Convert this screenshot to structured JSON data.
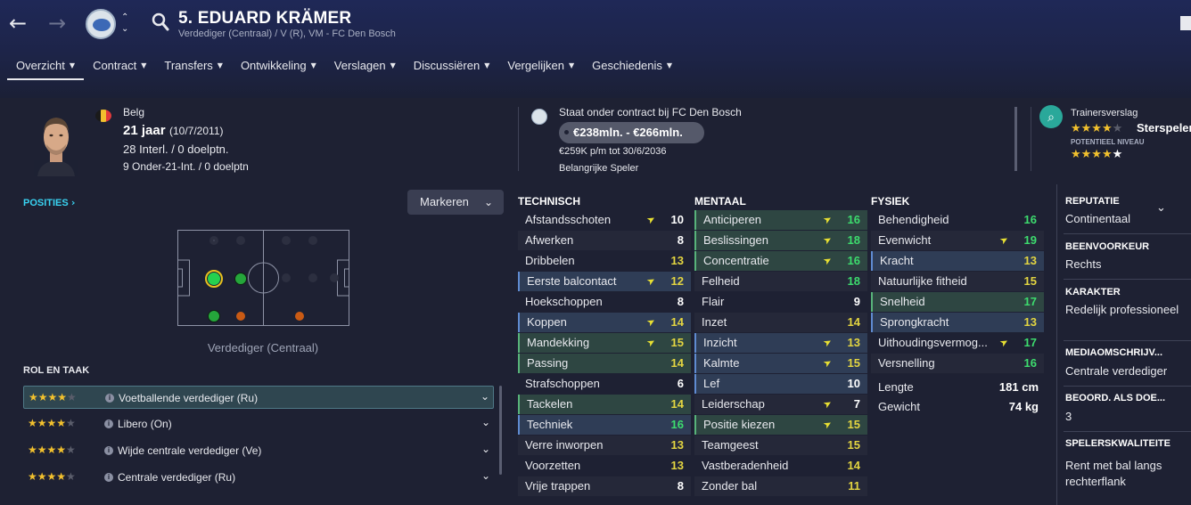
{
  "header": {
    "player_name": "5. EDUARD KRÄMER",
    "player_sub": "Verdediger (Centraal) / V (R), VM - FC Den Bosch",
    "tabs": [
      {
        "label": "Overzicht"
      },
      {
        "label": "Contract"
      },
      {
        "label": "Transfers"
      },
      {
        "label": "Ontwikkeling"
      },
      {
        "label": "Verslagen"
      },
      {
        "label": "Discussiëren"
      },
      {
        "label": "Vergelijken"
      },
      {
        "label": "Geschiedenis"
      }
    ]
  },
  "profile": {
    "nationality": "Belg",
    "age": "21 jaar",
    "dob": "(10/7/2011)",
    "caps": "28 Interl. / 0 doelptn.",
    "u21_caps": "9 Onder-21-Int. / 0 doelptn",
    "flag_colors": [
      "#1a1a1a",
      "#f2c12e",
      "#e23b3b"
    ]
  },
  "contract": {
    "status": "Staat onder contract bij FC Den Bosch",
    "value": "€238mln. - €266mln.",
    "wage": "€259K p/m tot 30/6/2036",
    "role": "Belangrijke Speler"
  },
  "scout": {
    "title": "Trainersverslag",
    "current_ability_stars": 4,
    "verdict": "Sterspeler",
    "potential_label": "POTENTIEEL NIVEAU",
    "potential_stars": 5
  },
  "left": {
    "posities": "POSITIES",
    "markeren": "Markeren",
    "pitch_label": "Verdediger (Centraal)",
    "rol_title": "ROL EN TAAK",
    "roles": [
      {
        "name": "Voetballende verdediger (Ru)",
        "stars": 4
      },
      {
        "name": "Libero (On)",
        "stars": 4
      },
      {
        "name": "Wijde centrale verdediger (Ve)",
        "stars": 4
      },
      {
        "name": "Centrale verdediger (Ru)",
        "stars": 4
      }
    ]
  },
  "technisch": {
    "title": "TECHNISCH",
    "items": [
      {
        "name": "Afstandsschoten",
        "value": "10",
        "arrow": true
      },
      {
        "name": "Afwerken",
        "value": "8"
      },
      {
        "name": "Dribbelen",
        "value": "13"
      },
      {
        "name": "Eerste balcontact",
        "value": "12",
        "arrow": true
      },
      {
        "name": "Hoekschoppen",
        "value": "8"
      },
      {
        "name": "Koppen",
        "value": "14",
        "arrow": true
      },
      {
        "name": "Mandekking",
        "value": "15",
        "arrow": true
      },
      {
        "name": "Passing",
        "value": "14"
      },
      {
        "name": "Strafschoppen",
        "value": "6"
      },
      {
        "name": "Tackelen",
        "value": "14"
      },
      {
        "name": "Techniek",
        "value": "16"
      },
      {
        "name": "Verre inworpen",
        "value": "13"
      },
      {
        "name": "Voorzetten",
        "value": "13"
      },
      {
        "name": "Vrije trappen",
        "value": "8"
      }
    ]
  },
  "mentaal": {
    "title": "MENTAAL",
    "items": [
      {
        "name": "Anticiperen",
        "value": "16",
        "arrow": true
      },
      {
        "name": "Beslissingen",
        "value": "18",
        "arrow": true
      },
      {
        "name": "Concentratie",
        "value": "16",
        "arrow": true
      },
      {
        "name": "Felheid",
        "value": "18"
      },
      {
        "name": "Flair",
        "value": "9"
      },
      {
        "name": "Inzet",
        "value": "14"
      },
      {
        "name": "Inzicht",
        "value": "13",
        "arrow": true
      },
      {
        "name": "Kalmte",
        "value": "15",
        "arrow": true
      },
      {
        "name": "Lef",
        "value": "10"
      },
      {
        "name": "Leiderschap",
        "value": "7",
        "arrow": true
      },
      {
        "name": "Positie kiezen",
        "value": "15",
        "arrow": true
      },
      {
        "name": "Teamgeest",
        "value": "15"
      },
      {
        "name": "Vastberadenheid",
        "value": "14"
      },
      {
        "name": "Zonder bal",
        "value": "11"
      }
    ]
  },
  "fysiek": {
    "title": "FYSIEK",
    "items": [
      {
        "name": "Behendigheid",
        "value": "16"
      },
      {
        "name": "Evenwicht",
        "value": "19",
        "arrow": true
      },
      {
        "name": "Kracht",
        "value": "13"
      },
      {
        "name": "Natuurlijke fitheid",
        "value": "15"
      },
      {
        "name": "Snelheid",
        "value": "17"
      },
      {
        "name": "Sprongkracht",
        "value": "13"
      },
      {
        "name": "Uithoudingsvermog...",
        "value": "17",
        "arrow": true
      },
      {
        "name": "Versnelling",
        "value": "16"
      }
    ],
    "length_label": "Lengte",
    "length_value": "181 cm",
    "weight_label": "Gewicht",
    "weight_value": "74 kg"
  },
  "side": {
    "reputatie_label": "REPUTATIE",
    "reputatie_value": "Continentaal",
    "been_label": "BEENVOORKEUR",
    "been_value": "Rechts",
    "karakter_label": "KARAKTER",
    "karakter_value": "Redelijk professioneel",
    "media_label": "MEDIAOMSCHRIJV...",
    "media_value": "Centrale verdediger",
    "beoord_label": "BEOORD. ALS DOE...",
    "beoord_value": "3",
    "kwaliteit_label": "SPELERSKWALITEITE",
    "kwaliteit_value": "Rent met bal langs rechterflank"
  }
}
